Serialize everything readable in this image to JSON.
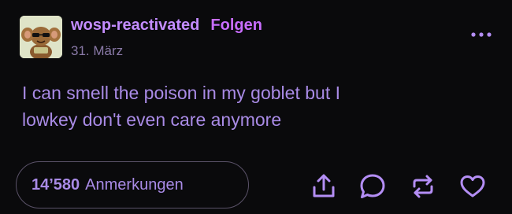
{
  "post": {
    "username": "wosp-reactivated",
    "follow_label": "Folgen",
    "date": "31. März",
    "body_lines": [
      "I can smell the poison in my goblet but I",
      "lowkey don't even care anymore"
    ],
    "notes_count": "14’580",
    "notes_label": "Anmerkungen"
  },
  "icons": {
    "more": "more-dots-icon",
    "share": "share-icon",
    "reply": "reply-bubble-icon",
    "reblog": "reblog-icon",
    "like": "heart-icon"
  },
  "colors": {
    "background": "#0a0a0c",
    "accent": "#c86dfe",
    "text": "#a98be6"
  }
}
